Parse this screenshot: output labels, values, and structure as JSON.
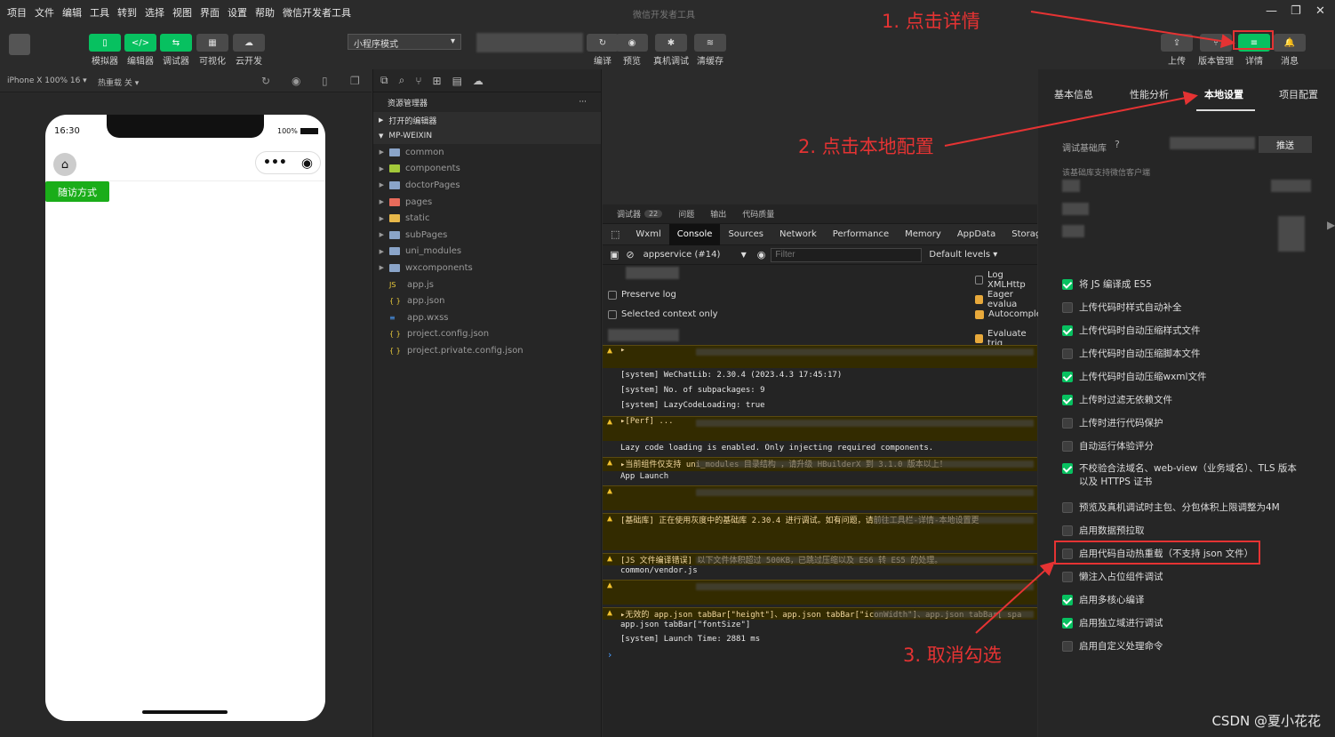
{
  "menubar": {
    "items": [
      "项目",
      "文件",
      "编辑",
      "工具",
      "转到",
      "选择",
      "视图",
      "界面",
      "设置",
      "帮助",
      "微信开发者工具"
    ],
    "title": "微信开发者工具"
  },
  "toolbar": {
    "left": [
      {
        "label": "模拟器",
        "icon": "phone-icon"
      },
      {
        "label": "编辑器",
        "icon": "code-icon"
      },
      {
        "label": "调试器",
        "icon": "debug-icon"
      },
      {
        "label": "可视化",
        "icon": "layout-icon"
      },
      {
        "label": "云开发",
        "icon": "cloud-icon"
      }
    ],
    "mode": "小程序模式",
    "center": [
      {
        "label": "编译",
        "icon": "refresh-icon"
      },
      {
        "label": "预览",
        "icon": "eye-icon"
      },
      {
        "label": "真机调试",
        "icon": "bug-icon"
      },
      {
        "label": "清缓存",
        "icon": "layers-icon"
      }
    ],
    "right": [
      {
        "label": "上传",
        "icon": "upload-icon"
      },
      {
        "label": "版本管理",
        "icon": "branch-icon"
      },
      {
        "label": "详情",
        "icon": "menu-icon"
      },
      {
        "label": "消息",
        "icon": "bell-icon"
      }
    ]
  },
  "simulator": {
    "device": "iPhone X 100% 16 ▾",
    "hotreload": "热重载 关 ▾",
    "time": "16:30",
    "battery": "100%",
    "button": "随访方式"
  },
  "explorer": {
    "title": "资源管理器",
    "open_editors": "打开的编辑器",
    "root": "MP-WEIXIN",
    "folders": [
      "common",
      "components",
      "doctorPages",
      "pages",
      "static",
      "subPages",
      "uni_modules",
      "wxcomponents"
    ],
    "files": [
      "app.js",
      "app.json",
      "app.wxss",
      "project.config.json",
      "project.private.config.json"
    ]
  },
  "devtools": {
    "tabs": [
      "调试器",
      "问题",
      "输出",
      "代码质量"
    ],
    "badge": "22",
    "panels": [
      "Wxml",
      "Console",
      "Sources",
      "Network",
      "Performance",
      "Memory",
      "AppData",
      "Storage"
    ],
    "context": "appservice (#14)",
    "filter_placeholder": "Filter",
    "levels": "Default levels ▾",
    "options_left": [
      "Preserve log",
      "Selected context only"
    ],
    "options_right": [
      "Log XMLHttp",
      "Eager evalua",
      "Autocomple",
      "Evaluate trig"
    ],
    "logs": [
      {
        "text": "▸",
        "warn": true
      },
      {
        "text": "[system] WeChatLib: 2.30.4 (2023.4.3 17:45:17)",
        "warn": false
      },
      {
        "text": "[system] No. of subpackages: 9",
        "warn": false
      },
      {
        "text": "[system] LazyCodeLoading: true",
        "warn": false
      },
      {
        "text": "▸[Perf] ...",
        "warn": true
      },
      {
        "text": "Lazy code loading is enabled. Only injecting required components.",
        "warn": false
      },
      {
        "text": "▸当前组件仅支持 uni_modules 目录结构 ，请升级 HBuilderX 到 3.1.0 版本以上！",
        "warn": true
      },
      {
        "text": "App Launch",
        "warn": false
      },
      {
        "text": "",
        "warn": true
      },
      {
        "text": "[基础库] 正在使用灰度中的基础库 2.30.4 进行调试。如有问题，请前往工具栏-详情-本地设置更",
        "warn": true
      },
      {
        "text": "[JS 文件编译错误] 以下文件体积超过 500KB，已跳过压缩以及 ES6 转 ES5 的处理。",
        "warn": true
      },
      {
        "text": "common/vendor.js",
        "warn": false
      },
      {
        "text": "",
        "warn": true
      },
      {
        "text": "▸无效的 app.json tabBar[\"height\"]、app.json tabBar[\"iconWidth\"]、app.json tabBar[ spa",
        "warn": true
      },
      {
        "text": "app.json tabBar[\"fontSize\"]",
        "warn": false
      },
      {
        "text": "[system] Launch Time: 2881 ms",
        "warn": false
      }
    ]
  },
  "details": {
    "tabs": [
      "基本信息",
      "性能分析",
      "本地设置",
      "项目配置"
    ],
    "lib_label": "调试基础库",
    "push": "推送",
    "lib_note": "该基础库支持微信客户端",
    "settings": [
      {
        "label": "将 JS 编译成 ES5",
        "on": true
      },
      {
        "label": "上传代码时样式自动补全",
        "on": false
      },
      {
        "label": "上传代码时自动压缩样式文件",
        "on": true
      },
      {
        "label": "上传代码时自动压缩脚本文件",
        "on": false
      },
      {
        "label": "上传代码时自动压缩wxml文件",
        "on": true
      },
      {
        "label": "上传时过滤无依赖文件",
        "on": true
      },
      {
        "label": "上传时进行代码保护",
        "on": false
      },
      {
        "label": "自动运行体验评分",
        "on": false
      },
      {
        "label": "不校验合法域名、web-view（业务域名）、TLS 版本以及 HTTPS 证书",
        "on": true
      },
      {
        "label": "预览及真机调试时主包、分包体积上限调整为4M",
        "on": false
      },
      {
        "label": "启用数据预拉取",
        "on": false
      },
      {
        "label": "启用代码自动热重载（不支持 json 文件）",
        "on": false
      },
      {
        "label": "懒注入占位组件调试",
        "on": false
      },
      {
        "label": "启用多核心编译",
        "on": true
      },
      {
        "label": "启用独立域进行调试",
        "on": true
      },
      {
        "label": "启用自定义处理命令",
        "on": false
      }
    ]
  },
  "annotations": {
    "step1": "1. 点击详情",
    "step2": "2. 点击本地配置",
    "step3": "3. 取消勾选"
  },
  "watermark": "CSDN @夏小花花",
  "colors": {
    "accent": "#07c160",
    "annotation": "#e53333",
    "warning": "#f2c12e"
  }
}
